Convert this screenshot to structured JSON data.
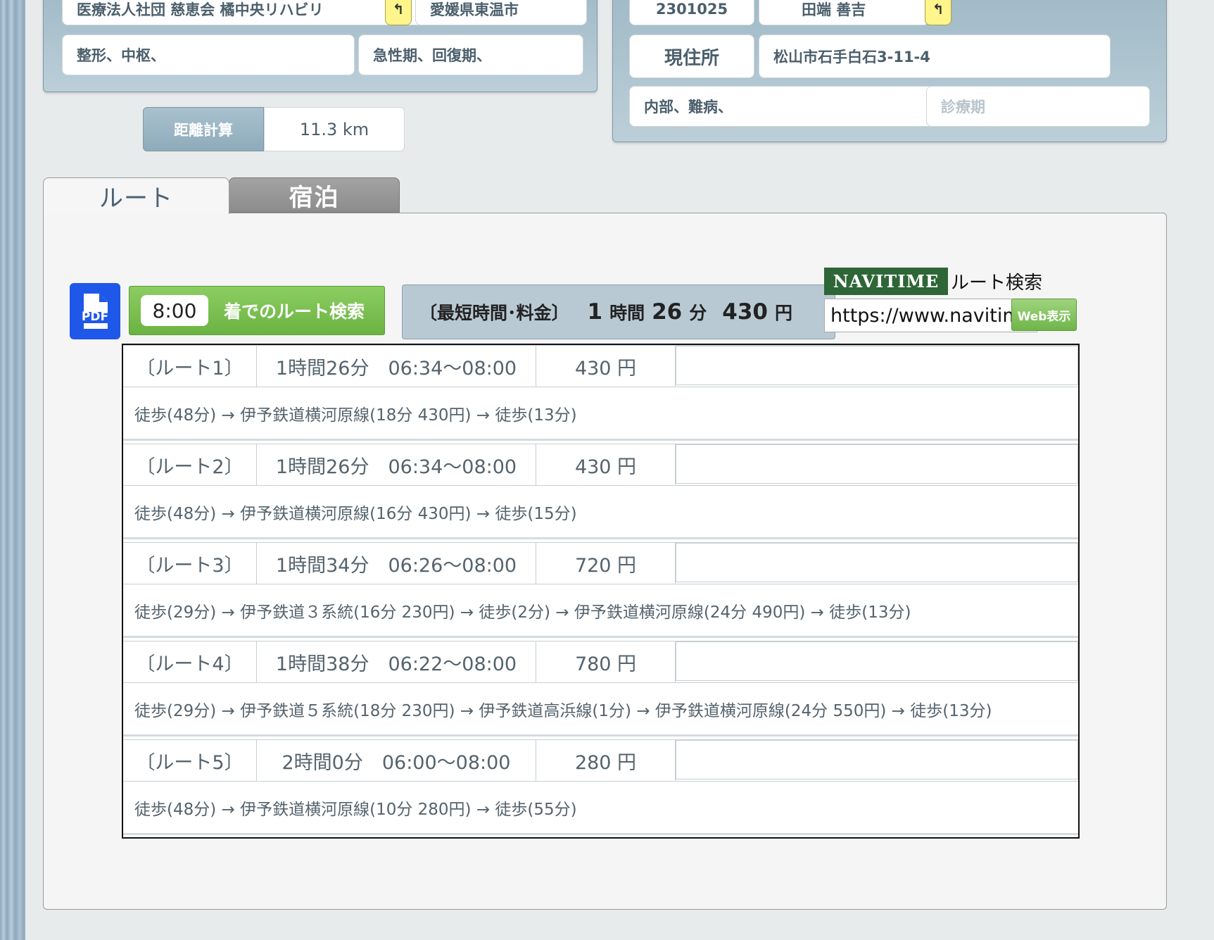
{
  "hospital_panel": {
    "facility_name": "医療法人社団 慈恵会 橘中央リハビリ",
    "prefecture_city": "愛媛県東温市",
    "departments": "整形、中枢、",
    "phases": "急性期、回復期、"
  },
  "patient_panel": {
    "patient_id": "2301025",
    "patient_name": "田端 善吉",
    "address_label": "現住所",
    "address": "松山市石手白石3-11-4",
    "departments": "内部、難病、",
    "phase_placeholder": "診療期"
  },
  "distance": {
    "button_label": "距離計算",
    "value": "11.3 km"
  },
  "tabs": [
    {
      "label": "ルート",
      "active": true
    },
    {
      "label": "宿泊",
      "active": false
    }
  ],
  "search": {
    "pdf_label": "PDF",
    "arrival_time": "8:00",
    "search_label": "着でのルート検索"
  },
  "summary": {
    "label": "〔最短時間･料金〕",
    "hours": "1",
    "hours_unit": "時間",
    "minutes": "26",
    "minutes_unit": "分",
    "price": "430",
    "price_unit": "円"
  },
  "navitime": {
    "logo": "NAVITIME",
    "title": "ルート検索",
    "url": "https://www.navitime.co.jp/",
    "web_button": "Web表示"
  },
  "routes": [
    {
      "name": "〔ルート1〕",
      "time": "1時間26分　06:34〜08:00",
      "price": "430 円",
      "detail": "徒歩(48分) → 伊予鉄道横河原線(18分 430円) → 徒歩(13分)"
    },
    {
      "name": "〔ルート2〕",
      "time": "1時間26分　06:34〜08:00",
      "price": "430 円",
      "detail": "徒歩(48分) → 伊予鉄道横河原線(16分 430円) → 徒歩(15分)"
    },
    {
      "name": "〔ルート3〕",
      "time": "1時間34分　06:26〜08:00",
      "price": "720 円",
      "detail": "徒歩(29分) → 伊予鉄道３系統(16分 230円) → 徒歩(2分) → 伊予鉄道横河原線(24分 490円) → 徒歩(13分)"
    },
    {
      "name": "〔ルート4〕",
      "time": "1時間38分　06:22〜08:00",
      "price": "780 円",
      "detail": "徒歩(29分) → 伊予鉄道５系統(18分 230円) → 伊予鉄道高浜線(1分) → 伊予鉄道横河原線(24分 550円) → 徒歩(13分)"
    },
    {
      "name": "〔ルート5〕",
      "time": "2時間0分　06:00〜08:00",
      "price": "280 円",
      "detail": "徒歩(48分) → 伊予鉄道横河原線(10分 280円) → 徒歩(55分)"
    }
  ]
}
